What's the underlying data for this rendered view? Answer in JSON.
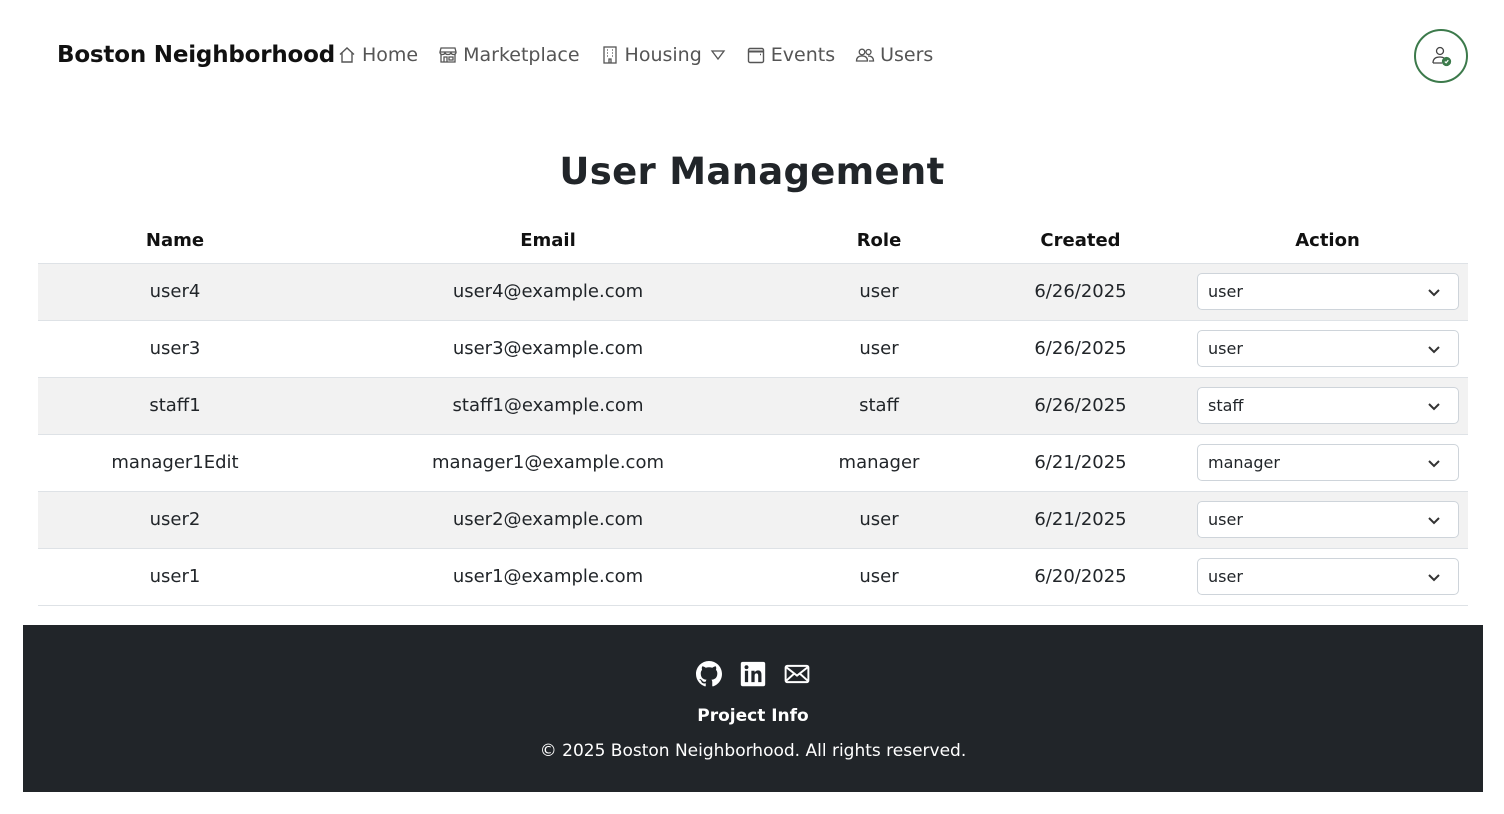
{
  "navbar": {
    "brand": "Boston Neighborhood",
    "links": [
      {
        "label": "Home",
        "icon": "house-icon"
      },
      {
        "label": "Marketplace",
        "icon": "shop-icon"
      },
      {
        "label": "Housing",
        "icon": "building-icon",
        "dropdown": true
      },
      {
        "label": "Events",
        "icon": "calendar-icon"
      },
      {
        "label": "Users",
        "icon": "people-icon"
      }
    ],
    "profile_icon": "user-check-icon",
    "accent_color": "#3c7a4b"
  },
  "page": {
    "title": "User Management"
  },
  "table": {
    "headers": {
      "name": "Name",
      "email": "Email",
      "role": "Role",
      "created": "Created",
      "action": "Action"
    },
    "rows": [
      {
        "name": "user4",
        "email": "user4@example.com",
        "role": "user",
        "created": "6/26/2025",
        "action": "user"
      },
      {
        "name": "user3",
        "email": "user3@example.com",
        "role": "user",
        "created": "6/26/2025",
        "action": "user"
      },
      {
        "name": "staff1",
        "email": "staff1@example.com",
        "role": "staff",
        "created": "6/26/2025",
        "action": "staff"
      },
      {
        "name": "manager1Edit",
        "email": "manager1@example.com",
        "role": "manager",
        "created": "6/21/2025",
        "action": "manager"
      },
      {
        "name": "user2",
        "email": "user2@example.com",
        "role": "user",
        "created": "6/21/2025",
        "action": "user"
      },
      {
        "name": "user1",
        "email": "user1@example.com",
        "role": "user",
        "created": "6/20/2025",
        "action": "user"
      }
    ],
    "stripe_color": "#f2f2f2"
  },
  "footer": {
    "social_icons": [
      "github-icon",
      "linkedin-icon",
      "envelope-icon"
    ],
    "project_info": "Project Info",
    "copyright": "© 2025 Boston Neighborhood. All rights reserved.",
    "background": "#212529"
  }
}
